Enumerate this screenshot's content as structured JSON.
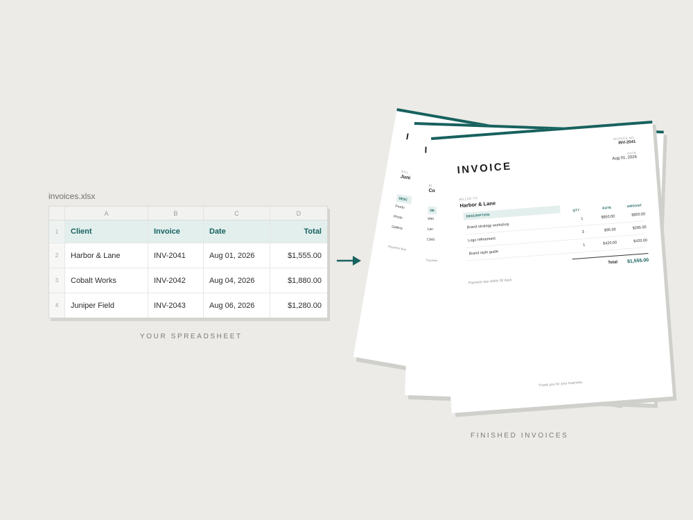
{
  "spreadsheet": {
    "file_name": "invoices.xlsx",
    "column_letters": [
      "A",
      "B",
      "C",
      "D"
    ],
    "row_numbers": [
      "1",
      "2",
      "3",
      "4"
    ],
    "header": [
      "Client",
      "Invoice",
      "Date",
      "Total"
    ],
    "rows": [
      [
        "Harbor & Lane",
        "INV-2041",
        "Aug 01, 2026",
        "$1,555.00"
      ],
      [
        "Cobalt Works",
        "INV-2042",
        "Aug 04, 2026",
        "$1,880.00"
      ],
      [
        "Juniper Field",
        "INV-2043",
        "Aug 06, 2026",
        "$1,280.00"
      ]
    ],
    "caption": "YOUR SPREADSHEET"
  },
  "invoices": {
    "caption": "FINISHED INVOICES",
    "accent_color": "#17615e",
    "front": {
      "title": "INVOICE",
      "invoice_no_label": "INVOICE NO.",
      "invoice_no": "INV-2041",
      "date_label": "DATE",
      "date": "Aug 01, 2026",
      "billed_to_label": "BILLED TO",
      "billed_to": "Harbor & Lane",
      "columns": [
        "DESCRIPTION",
        "QTY",
        "RATE",
        "AMOUNT"
      ],
      "items": [
        {
          "description": "Brand strategy workshop",
          "qty": "1",
          "rate": "$850.00",
          "amount": "$850.00"
        },
        {
          "description": "Logo refinement",
          "qty": "3",
          "rate": "$95.00",
          "amount": "$285.00"
        },
        {
          "description": "Brand style guide",
          "qty": "1",
          "rate": "$420.00",
          "amount": "$420.00"
        }
      ],
      "total_label": "Total",
      "total": "$1,555.00",
      "payment_note": "Payment due within 30 days.",
      "thanks": "Thank you for your business."
    },
    "back_middle": {
      "title": "I",
      "billed_to_label": "BI",
      "billed_to": "Co",
      "desc_header": "DE",
      "items": [
        "Wel",
        "Lan",
        "CMS"
      ],
      "payment_note": "Paymen"
    },
    "back_rear": {
      "title": "I",
      "billed_to_label": "BILL",
      "billed_to": "Juni",
      "desc_header": "DESC",
      "items": [
        "Produ",
        "Photo",
        "Gallery"
      ],
      "payment_note": "Payment due"
    }
  }
}
